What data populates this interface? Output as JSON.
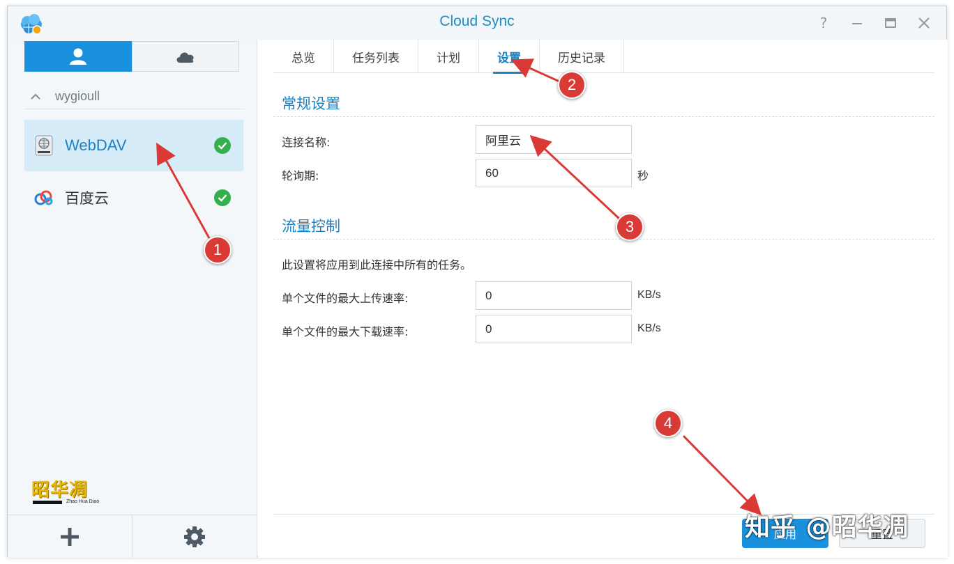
{
  "window": {
    "title": "Cloud Sync"
  },
  "sidebar": {
    "segments": [
      {
        "icon": "user-icon"
      },
      {
        "icon": "cloud-icon"
      }
    ],
    "group": {
      "name": "wygioull"
    },
    "connections": [
      {
        "label": "WebDAV",
        "icon": "webdav-drive-icon",
        "status": "ok",
        "active": true
      },
      {
        "label": "百度云",
        "icon": "baidu-cloud-icon",
        "status": "ok",
        "active": false
      }
    ],
    "footer": {
      "add_icon": "plus-icon",
      "settings_icon": "gear-icon"
    }
  },
  "logo": {
    "text": "昭华凋",
    "subtitle": "Zhao Hua Diao"
  },
  "tabs": [
    {
      "label": "总览"
    },
    {
      "label": "任务列表"
    },
    {
      "label": "计划"
    },
    {
      "label": "设置",
      "active": true
    },
    {
      "label": "历史记录"
    }
  ],
  "general": {
    "title": "常规设置",
    "conn_name_label": "连接名称:",
    "conn_name_value": "阿里云",
    "poll_label": "轮询期:",
    "poll_value": "60",
    "poll_unit": "秒"
  },
  "traffic": {
    "title": "流量控制",
    "description": "此设置将应用到此连接中所有的任务。",
    "upload_label": "单个文件的最大上传速率:",
    "upload_value": "0",
    "upload_unit": "KB/s",
    "download_label": "单个文件的最大下载速率:",
    "download_value": "0",
    "download_unit": "KB/s"
  },
  "buttons": {
    "apply": "应用",
    "reset": "重置"
  },
  "watermark": "知乎 @昭华凋",
  "annotations": [
    "1",
    "2",
    "3",
    "4"
  ],
  "colors": {
    "accent": "#1a91dd",
    "annotation": "#d93a36",
    "ok": "#33b04c"
  }
}
